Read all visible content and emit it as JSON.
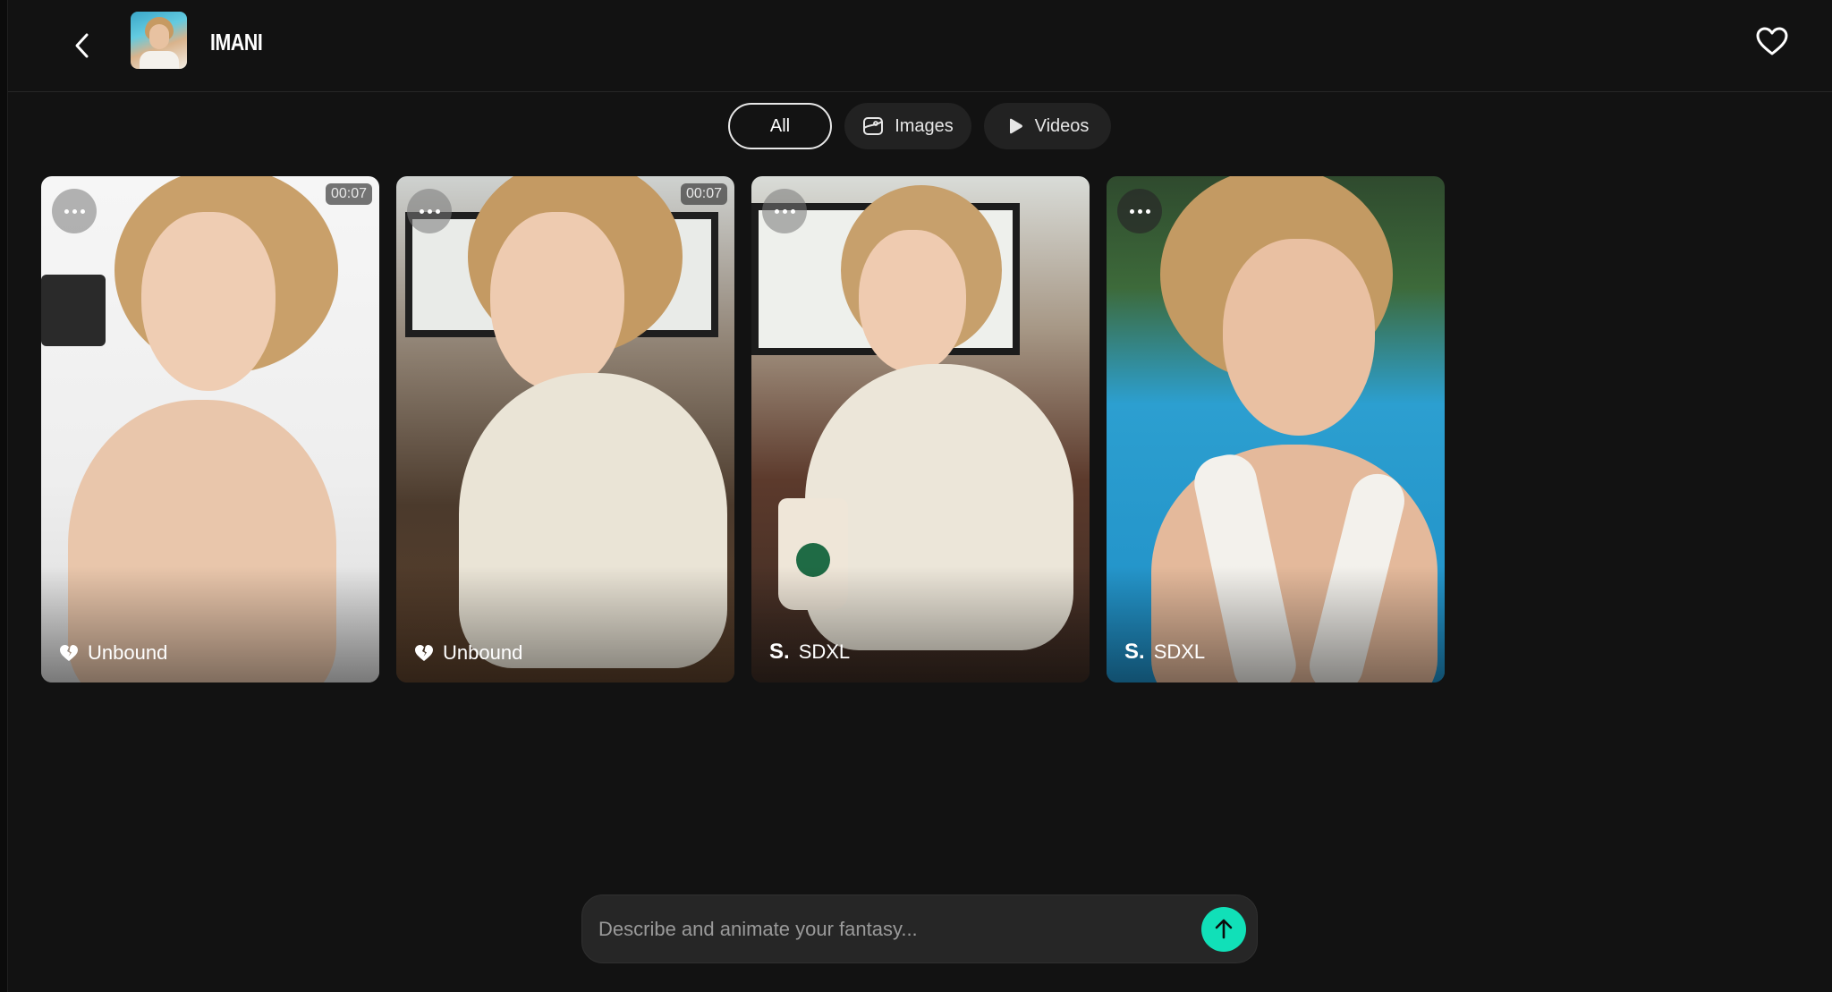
{
  "header": {
    "character_name": "IMANI",
    "back_icon": "chevron-left-icon",
    "favorite_icon": "heart-icon"
  },
  "tabs": [
    {
      "label": "All",
      "active": true,
      "icon": ""
    },
    {
      "label": "Images",
      "active": false,
      "icon": "image-icon"
    },
    {
      "label": "Videos",
      "active": false,
      "icon": "play-icon"
    }
  ],
  "cards": [
    {
      "duration": "00:07",
      "model": "Unbound",
      "model_icon": "heart-broken-icon",
      "kind": "video"
    },
    {
      "duration": "00:07",
      "model": "Unbound",
      "model_icon": "heart-broken-icon",
      "kind": "video"
    },
    {
      "duration": "",
      "model": "SDXL",
      "model_icon": "S.",
      "kind": "image"
    },
    {
      "duration": "",
      "model": "SDXL",
      "model_icon": "S.",
      "kind": "image"
    }
  ],
  "prompt": {
    "placeholder": "Describe and animate your fantasy...",
    "send_icon": "arrow-up-icon"
  },
  "colors": {
    "background": "#121212",
    "accent": "#11e0b8",
    "tab_bg": "#222222"
  }
}
